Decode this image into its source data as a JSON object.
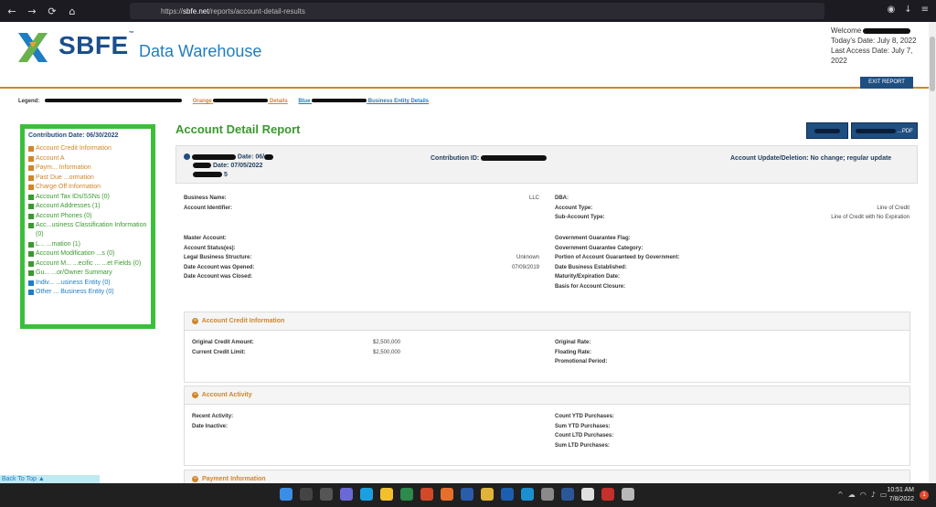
{
  "browser": {
    "url_prefix": "https://",
    "url_host": "sbfe.net",
    "url_path": "/reports/account-detail-results"
  },
  "header": {
    "logo": "SBFE",
    "title": "Data Warehouse",
    "welcome": "Welcome",
    "todays_date": "Today's Date: July 8, 2022",
    "last_access": "Last Access Date: July 7, 2022",
    "exit_button": "EXIT REPORT"
  },
  "legend": {
    "label": "Legend:",
    "orange": "Orange",
    "orange_tail": "Details",
    "blue": "Blue",
    "blue_tail": "Business Entity Details"
  },
  "sidebar": {
    "title": "Contribution Date: 06/30/2022",
    "items": [
      {
        "label": "Account Credit Information",
        "color": "orange"
      },
      {
        "label": "Account A",
        "color": "orange"
      },
      {
        "label": "Paym... Information",
        "color": "orange"
      },
      {
        "label": "Past Due ...ormation",
        "color": "orange"
      },
      {
        "label": "Charge Off Information",
        "color": "orange"
      },
      {
        "label": "Account Tax IDs/SSNs (0)",
        "color": "green"
      },
      {
        "label": "Account Addresses (1)",
        "color": "green"
      },
      {
        "label": "Account Phones (0)",
        "color": "green"
      },
      {
        "label": "Acc...usiness Classification Information (0)",
        "color": "green"
      },
      {
        "label": "L... ...mation (1)",
        "color": "green"
      },
      {
        "label": "Account Modification ...s (0)",
        "color": "green"
      },
      {
        "label": "Account M... ...ecific ... ...et Fields (0)",
        "color": "green"
      },
      {
        "label": "Gu... ...or/Owner Summary",
        "color": "green"
      },
      {
        "label": "Indiv... ...usiness Entity (0)",
        "color": "blue"
      },
      {
        "label": "Other ... Business Entity (0)",
        "color": "blue"
      }
    ],
    "back_to_top": "Back To Top"
  },
  "report": {
    "title": "Account Detail Report",
    "btn_1": "...",
    "btn_2": "...PDF",
    "date_label": "Date: 06/",
    "date_label_2": "Date: 07/05/2022",
    "count": "5",
    "contribution_id_label": "Contribution ID:",
    "update_status": "Account Update/Deletion: No change; regular update"
  },
  "account_left": [
    {
      "label": "Business Name:",
      "value": "LLC"
    },
    {
      "label": "Account Identifier:",
      "value": ""
    }
  ],
  "account_right": [
    {
      "label": "DBA:",
      "value": ""
    },
    {
      "label": "Account Type:",
      "value": "Line of Credit"
    },
    {
      "label": "Sub-Account Type:",
      "value": "Line of Credit with No Expiration"
    }
  ],
  "master_left": [
    {
      "label": "Master Account:",
      "value": ""
    },
    {
      "label": "Account Status(es):",
      "value": ""
    },
    {
      "label": "Legal Business Structure:",
      "value": "Unknown"
    },
    {
      "label": "Date Account was Opened:",
      "value": "07/09/2019"
    },
    {
      "label": "Date Account was Closed:",
      "value": ""
    }
  ],
  "master_right": [
    {
      "label": "Government Guarantee Flag:",
      "value": ""
    },
    {
      "label": "Government Guarantee Category:",
      "value": ""
    },
    {
      "label": "Portion of Account Guaranteed by Government:",
      "value": ""
    },
    {
      "label": "Date Business Established:",
      "value": ""
    },
    {
      "label": "Maturity/Expiration Date:",
      "value": ""
    },
    {
      "label": "Basis for Account Closure:",
      "value": ""
    }
  ],
  "credit": {
    "heading": "Account Credit Information",
    "left": [
      {
        "label": "Original Credit Amount:",
        "value": "$2,500,000"
      },
      {
        "label": "Current Credit Limit:",
        "value": "$2,500,000"
      }
    ],
    "right": [
      {
        "label": "Original Rate:",
        "value": ""
      },
      {
        "label": "Floating Rate:",
        "value": ""
      },
      {
        "label": "Promotional Period:",
        "value": ""
      }
    ]
  },
  "activity": {
    "heading": "Account Activity",
    "left": [
      {
        "label": "Recent Activity:",
        "value": ""
      },
      {
        "label": "Date Inactive:",
        "value": ""
      }
    ],
    "right": [
      {
        "label": "Count YTD Purchases:",
        "value": ""
      },
      {
        "label": "Sum YTD Purchases:",
        "value": ""
      },
      {
        "label": "Count LTD Purchases:",
        "value": ""
      },
      {
        "label": "Sum LTD Purchases:",
        "value": ""
      }
    ]
  },
  "payment": {
    "heading": "Payment Information"
  },
  "taskbar": {
    "time": "10:51 AM",
    "date": "7/8/2022",
    "notifications": "1"
  }
}
